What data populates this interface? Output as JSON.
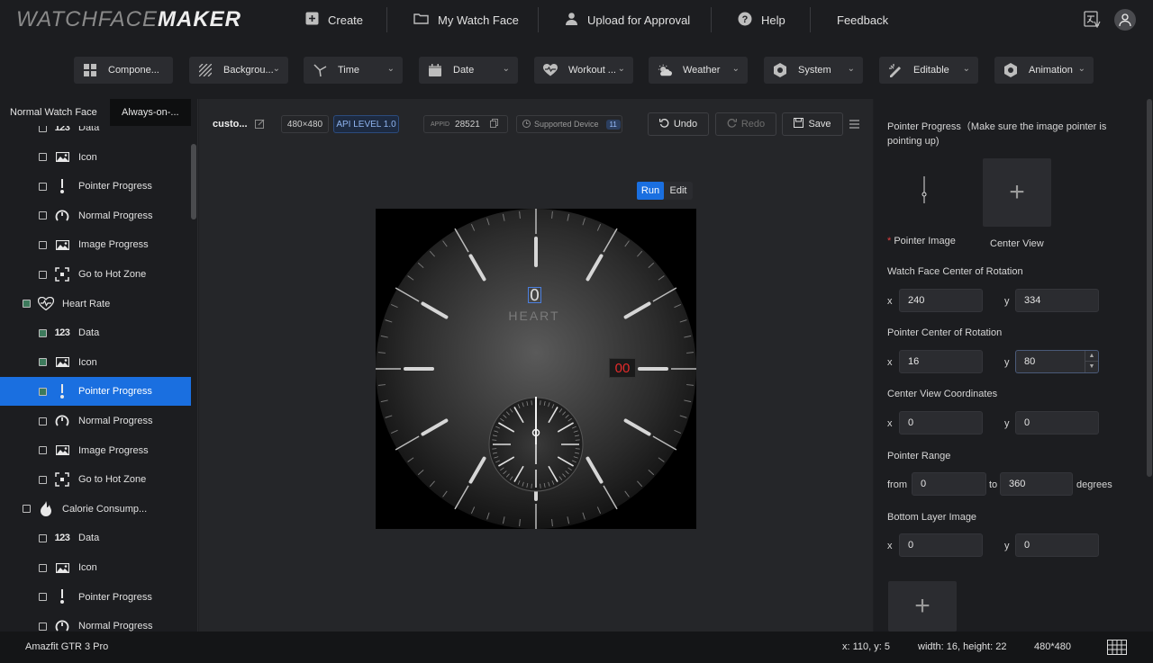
{
  "app": {
    "logo_light": "WATCHFACE",
    "logo_bold": "MAKER"
  },
  "nav": {
    "create": "Create",
    "my_watch_face": "My Watch Face",
    "upload": "Upload for Approval",
    "help": "Help",
    "feedback": "Feedback"
  },
  "categories": [
    {
      "label": "Compone...",
      "icon": "component-icon"
    },
    {
      "label": "Backgrou...",
      "icon": "background-icon"
    },
    {
      "label": "Time",
      "icon": "time-icon"
    },
    {
      "label": "Date",
      "icon": "calendar-icon"
    },
    {
      "label": "Workout ...",
      "icon": "heart-icon"
    },
    {
      "label": "Weather",
      "icon": "weather-icon"
    },
    {
      "label": "System",
      "icon": "system-icon"
    },
    {
      "label": "Editable",
      "icon": "editable-icon"
    },
    {
      "label": "Animation",
      "icon": "animation-icon"
    }
  ],
  "left_tabs": {
    "normal": "Normal Watch Face",
    "aod": "Always-on-..."
  },
  "tree": [
    {
      "label": "Data",
      "icon": "123",
      "indent": 2,
      "checked": false
    },
    {
      "label": "Icon",
      "icon": "image",
      "indent": 2,
      "checked": false
    },
    {
      "label": "Pointer Progress",
      "icon": "pointer",
      "indent": 2,
      "checked": false
    },
    {
      "label": "Normal Progress",
      "icon": "gauge",
      "indent": 2,
      "checked": false
    },
    {
      "label": "Image Progress",
      "icon": "image",
      "indent": 2,
      "checked": false
    },
    {
      "label": "Go to Hot Zone",
      "icon": "hotzone",
      "indent": 2,
      "checked": false
    },
    {
      "label": "Heart Rate",
      "icon": "heart",
      "indent": 1,
      "checked": true
    },
    {
      "label": "Data",
      "icon": "123",
      "indent": 2,
      "checked": true
    },
    {
      "label": "Icon",
      "icon": "image",
      "indent": 2,
      "checked": true
    },
    {
      "label": "Pointer Progress",
      "icon": "pointer",
      "indent": 2,
      "checked": true,
      "selected": true
    },
    {
      "label": "Normal Progress",
      "icon": "gauge",
      "indent": 2,
      "checked": false
    },
    {
      "label": "Image Progress",
      "icon": "image",
      "indent": 2,
      "checked": false
    },
    {
      "label": "Go to Hot Zone",
      "icon": "hotzone",
      "indent": 2,
      "checked": false
    },
    {
      "label": "Calorie Consump...",
      "icon": "flame",
      "indent": 1,
      "checked": false
    },
    {
      "label": "Data",
      "icon": "123",
      "indent": 2,
      "checked": false
    },
    {
      "label": "Icon",
      "icon": "image",
      "indent": 2,
      "checked": false
    },
    {
      "label": "Pointer Progress",
      "icon": "pointer",
      "indent": 2,
      "checked": false
    },
    {
      "label": "Normal Progress",
      "icon": "gauge",
      "indent": 2,
      "checked": false
    }
  ],
  "editor": {
    "name": "custo...",
    "resolution": "480×480",
    "api_level": "API LEVEL  1.0",
    "appid_label": "APPID",
    "appid": "28521",
    "supported_label": "Supported Device",
    "supported_count": "11",
    "undo": "Undo",
    "redo": "Redo",
    "save": "Save",
    "run": "Run",
    "edit": "Edit"
  },
  "watch": {
    "data_value": "0",
    "data_label": "HEART",
    "date_value": "00"
  },
  "props": {
    "title": "Pointer Progress（Make sure the image pointer is pointing up)",
    "pointer_image": "Pointer Image",
    "center_view": "Center View",
    "wf_center_label": "Watch Face Center of Rotation",
    "wf_x": "240",
    "wf_y": "334",
    "ptr_center_label": "Pointer Center of Rotation",
    "ptr_x": "16",
    "ptr_y": "80",
    "cv_label": "Center View Coordinates",
    "cv_x": "0",
    "cv_y": "0",
    "range_label": "Pointer Range",
    "from_label": "from",
    "from": "0",
    "to_label": "to",
    "to": "360",
    "degrees": "degrees",
    "bottom_label": "Bottom Layer Image",
    "b_x": "0",
    "b_y": "0",
    "x": "x",
    "y": "y"
  },
  "status": {
    "device": "Amazfit GTR 3 Pro",
    "coords": "x: 110, y: 5",
    "size": "width: 16, height: 22",
    "canvas": "480*480"
  }
}
